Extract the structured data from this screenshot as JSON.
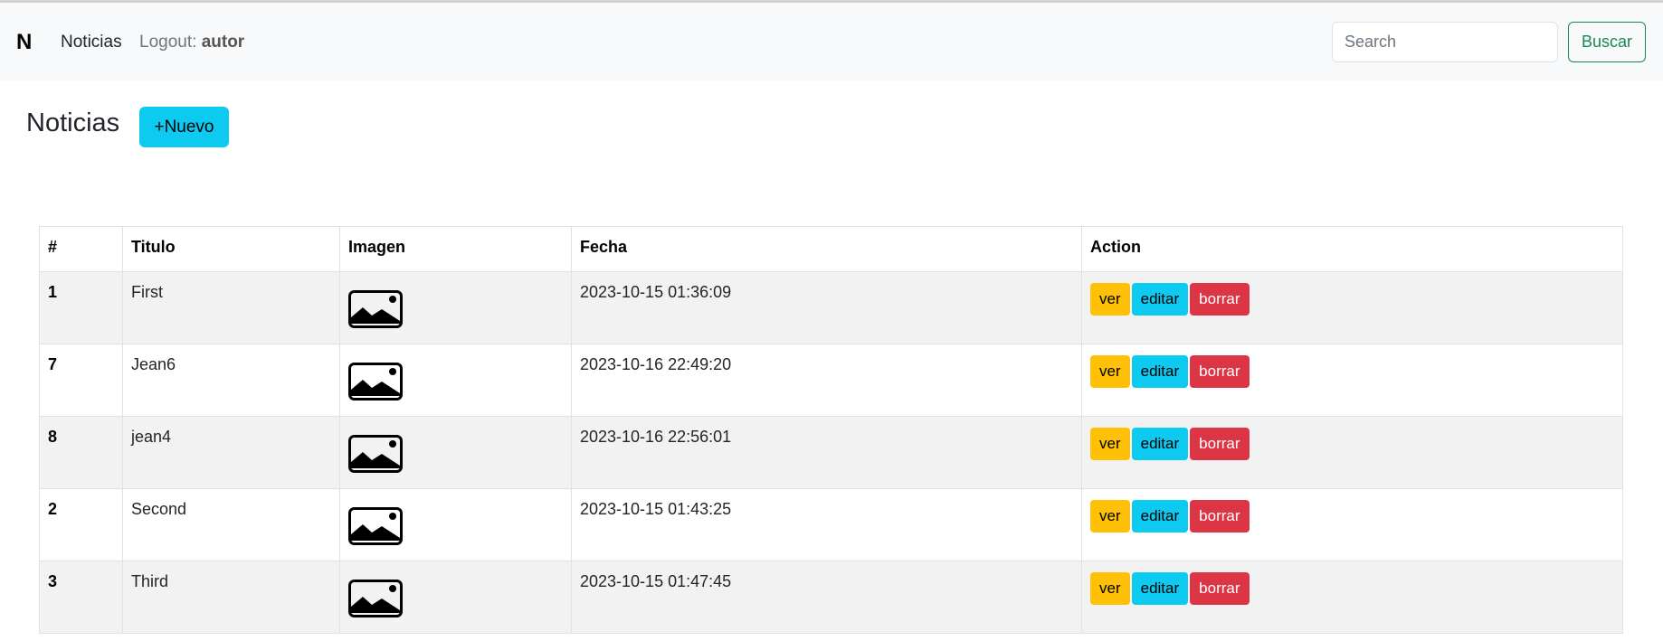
{
  "navbar": {
    "brand": "N",
    "link_noticias": "Noticias",
    "logout_prefix": "Logout:",
    "logout_user": "autor",
    "search_placeholder": "Search",
    "search_button": "Buscar"
  },
  "page": {
    "title": "Noticias",
    "new_button": "+Nuevo"
  },
  "table": {
    "headers": [
      "#",
      "Titulo",
      "Imagen",
      "Fecha",
      "Action"
    ],
    "rows": [
      {
        "id": "1",
        "titulo": "First",
        "fecha": "2023-10-15 01:36:09"
      },
      {
        "id": "7",
        "titulo": "Jean6",
        "fecha": "2023-10-16 22:49:20"
      },
      {
        "id": "8",
        "titulo": "jean4",
        "fecha": "2023-10-16 22:56:01"
      },
      {
        "id": "2",
        "titulo": "Second",
        "fecha": "2023-10-15 01:43:25"
      },
      {
        "id": "3",
        "titulo": "Third",
        "fecha": "2023-10-15 01:47:45"
      }
    ],
    "actions": {
      "ver": "ver",
      "editar": "editar",
      "borrar": "borrar"
    }
  },
  "colors": {
    "ver": "#ffc107",
    "editar": "#0dcaf0",
    "borrar": "#dc3545",
    "search_outline": "#198754",
    "nuevo": "#0dcaf0"
  },
  "icons": {
    "imagen": "image-icon"
  }
}
